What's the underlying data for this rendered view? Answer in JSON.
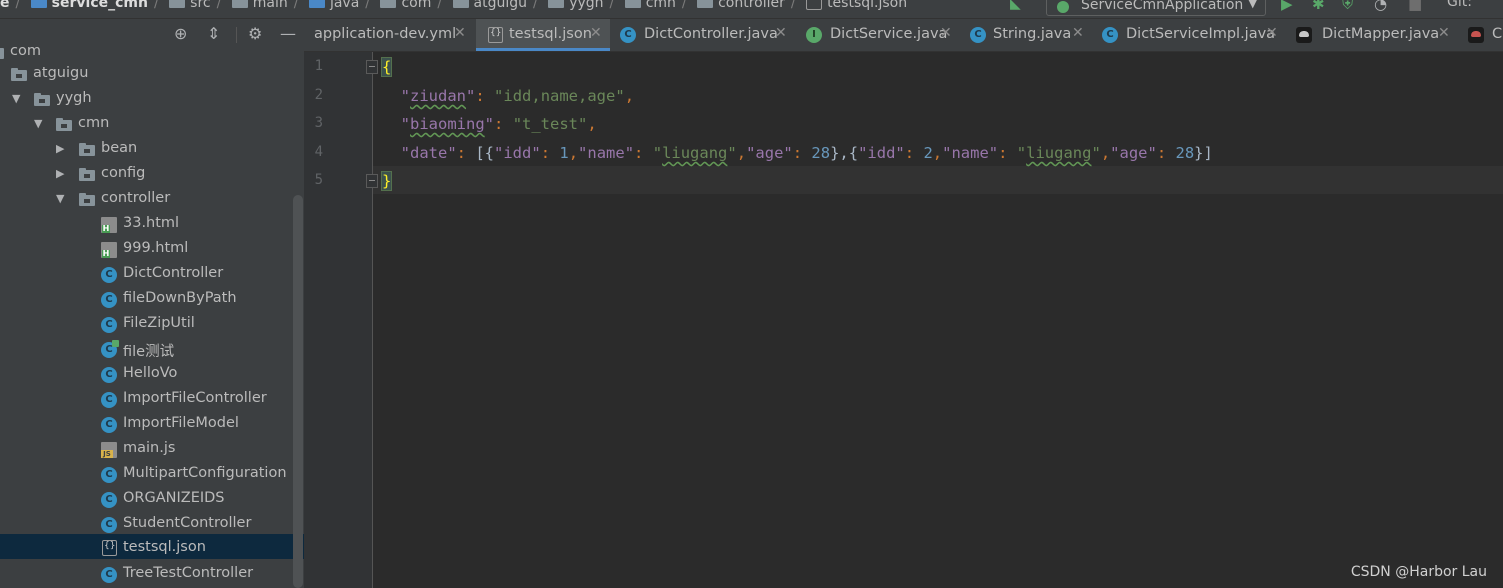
{
  "breadcrumb": {
    "items": [
      "e",
      "service_cmn",
      "src",
      "main",
      "java",
      "com",
      "atguigu",
      "yygh",
      "cmn",
      "controller",
      "testsql.json"
    ]
  },
  "run_config": {
    "label": "ServiceCmnApplication"
  },
  "vcs": {
    "label": "Git:"
  },
  "project_tree": {
    "top_partial": "com",
    "nodes": [
      {
        "label": "atguigu",
        "icon": "folder-icon",
        "expanded": false
      },
      {
        "label": "yygh",
        "icon": "folder-icon",
        "expanded": true
      },
      {
        "label": "cmn",
        "icon": "folder-icon",
        "expanded": true
      },
      {
        "label": "bean",
        "icon": "folder-icon",
        "expanded": false
      },
      {
        "label": "config",
        "icon": "folder-icon",
        "expanded": false
      },
      {
        "label": "controller",
        "icon": "folder-icon",
        "expanded": true
      },
      {
        "label": "33.html",
        "icon": "html-file-icon"
      },
      {
        "label": "999.html",
        "icon": "html-file-icon"
      },
      {
        "label": "DictController",
        "icon": "java-class-icon"
      },
      {
        "label": "fileDownByPath",
        "icon": "java-class-icon"
      },
      {
        "label": "FileZipUtil",
        "icon": "java-class-icon"
      },
      {
        "label": "file测试",
        "icon": "java-runnable-class-icon"
      },
      {
        "label": "HelloVo",
        "icon": "java-class-icon"
      },
      {
        "label": "ImportFileController",
        "icon": "java-class-icon"
      },
      {
        "label": "ImportFileModel",
        "icon": "java-class-icon"
      },
      {
        "label": "main.js",
        "icon": "js-file-icon"
      },
      {
        "label": "MultipartConfiguration",
        "icon": "java-class-icon"
      },
      {
        "label": "ORGANIZEIDS",
        "icon": "java-class-icon"
      },
      {
        "label": "StudentController",
        "icon": "java-class-icon"
      },
      {
        "label": "testsql.json",
        "icon": "json-file-icon",
        "selected": true
      },
      {
        "label": "TreeTestController",
        "icon": "java-class-icon"
      }
    ]
  },
  "tabs": [
    {
      "label": "application-dev.yml",
      "icon": "",
      "active": false
    },
    {
      "label": "testsql.json",
      "icon": "json-file-icon",
      "active": true
    },
    {
      "label": "DictController.java",
      "icon": "java-class-icon",
      "active": false
    },
    {
      "label": "DictService.java",
      "icon": "java-interface-icon",
      "active": false
    },
    {
      "label": "String.java",
      "icon": "java-class-icon",
      "active": false
    },
    {
      "label": "DictServiceImpl.java",
      "icon": "java-class-icon",
      "active": false
    },
    {
      "label": "DictMapper.java",
      "icon": "mybatis-mapper-icon",
      "active": false
    },
    {
      "label": "C",
      "icon": "mybatis-mapper-icon",
      "active": false
    }
  ],
  "editor": {
    "line_numbers": [
      "1",
      "2",
      "3",
      "4",
      "5"
    ],
    "lines": [
      "{",
      "  \"ziudan\": \"idd,name,age\",",
      "  \"biaoming\": \"t_test\",",
      "  \"date\": [{\"idd\": 1,\"name\": \"liugang\",\"age\": 28},{\"idd\": 2,\"name\": \"liugang\",\"age\": 28}]",
      "}"
    ],
    "tokens": {
      "k_ziudan": "\"ziudan\"",
      "v_ziudan": "\"idd,name,age\"",
      "k_biaoming": "\"biaoming\"",
      "v_biaoming": "\"t_test\"",
      "k_date": "\"date\"",
      "k_idd": "\"idd\"",
      "k_name": "\"name\"",
      "k_age": "\"age\"",
      "v_name": "\"liugang\"",
      "n1": "1",
      "n2": "2",
      "n28": "28"
    }
  },
  "watermark": "CSDN @Harbor Lau",
  "colors": {
    "background": "#2b2b2b",
    "panel": "#3c3f41",
    "selection": "#0d293e",
    "accent": "#4a88c7",
    "json_key": "#9876aa",
    "json_string": "#6a8759",
    "json_number": "#6897bb"
  }
}
